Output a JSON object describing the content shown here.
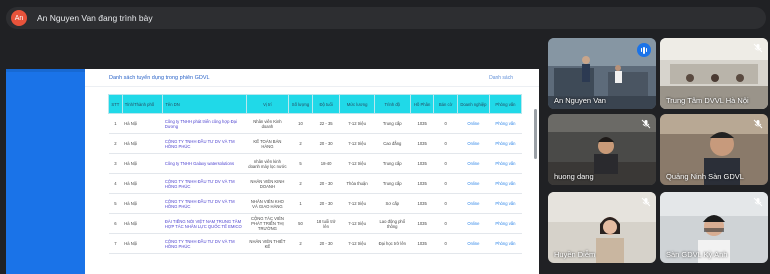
{
  "presenter": {
    "initials": "An",
    "text": "An Nguyen Van đang trình bày"
  },
  "sheet": {
    "title": "Danh sách tuyển dụng trong phiên GDVL",
    "right_label": "Danh sách"
  },
  "table": {
    "headers": [
      "STT",
      "Tỉnh/Thành phố",
      "Tên DN",
      "Vị trí",
      "Số lượng",
      "Độ tuổi",
      "Mức lương",
      "Trình độ",
      "Hồ Phân",
      "Bán cờ",
      "Doanh nghiệp",
      "Phỏng vấn"
    ],
    "rows": [
      [
        "1",
        "Hà Nội",
        "Công ty TNHH phát triển công hợp Đại Dương",
        "Nhân viên Kinh doanh",
        "10",
        "22 - 35",
        "7-12 triệu",
        "Trung cấp",
        "1035",
        "0",
        "Online",
        "Phỏng vấn"
      ],
      [
        "2",
        "Hà Nội",
        "CÔNG TY TNHH ĐẦU TƯ DV VÀ TM HỒNG PHÚC",
        "KẾ TOÁN BÁN HÀNG",
        "2",
        "20 - 30",
        "7-12 triệu",
        "Cao đẳng",
        "1035",
        "0",
        "Online",
        "Phỏng vấn"
      ],
      [
        "3",
        "Hà Nội",
        "Công ty TNHH Galaxy watersolutions",
        "nhân viên kinh doanh máy lọc nước",
        "5",
        "18-40",
        "7-12 triệu",
        "Trung cấp",
        "1035",
        "0",
        "Online",
        "Phỏng vấn"
      ],
      [
        "4",
        "Hà Nội",
        "CÔNG TY TNHH ĐẦU TƯ DV VÀ TM HỒNG PHÚC",
        "NHÂN VIÊN KINH DOANH",
        "2",
        "20 - 30",
        "Thỏa thuận",
        "Trung cấp",
        "1035",
        "0",
        "Online",
        "Phỏng vấn"
      ],
      [
        "5",
        "Hà Nội",
        "CÔNG TY TNHH ĐẦU TƯ DV VÀ TM HỒNG PHÚC",
        "NHÂN VIÊN KHO VÀ GIAO HÀNG",
        "1",
        "20 - 30",
        "7-12 triệu",
        "Sơ cấp",
        "1035",
        "0",
        "Online",
        "Phỏng vấn"
      ],
      [
        "6",
        "Hà Nội",
        "ĐÀI TIẾNG NÓI VIỆT NAM TRUNG TÂM HỢP TÁC NHÂN LỰC QUỐC TẾ EMICO",
        "CỘNG TÁC VIÊN PHÁT TRIỂN THỊ TRƯỜNG",
        "50",
        "18 tuổi trở lên",
        "7-12 triệu",
        "Lao động phổ thông",
        "1035",
        "0",
        "Online",
        "Phỏng vấn"
      ],
      [
        "7",
        "Hà Nội",
        "CÔNG TY TNHH ĐẦU TƯ DV VÀ TM HỒNG PHÚC",
        "NHÂN VIÊN THIẾT KẾ",
        "2",
        "20 - 30",
        "7-12 triệu",
        "Đại học trở lên",
        "1035",
        "0",
        "Online",
        "Phỏng vấn"
      ]
    ]
  },
  "participants": [
    {
      "name": "An Nguyen Van",
      "state": "speaking"
    },
    {
      "name": "Trung Tâm DVVL Hà Nội",
      "state": "muted"
    },
    {
      "name": "huong dang",
      "state": "muted"
    },
    {
      "name": "Quảng Ninh Sàn GDVL",
      "state": "muted"
    },
    {
      "name": "Huyền Diễm",
      "state": "muted"
    },
    {
      "name": "Sàn GDVL Kỳ Anh",
      "state": "muted"
    }
  ],
  "colors": {
    "background": "#202124",
    "presenter_bar": "#2d2e31",
    "avatar": "#e8533b",
    "table_header": "#20d9e8",
    "link": "#4a3fcf",
    "action": "#2f86e9",
    "speaking": "#1a73e8"
  },
  "icons": {
    "muted": "mic-off-icon",
    "speaking": "speaking-indicator-icon"
  }
}
